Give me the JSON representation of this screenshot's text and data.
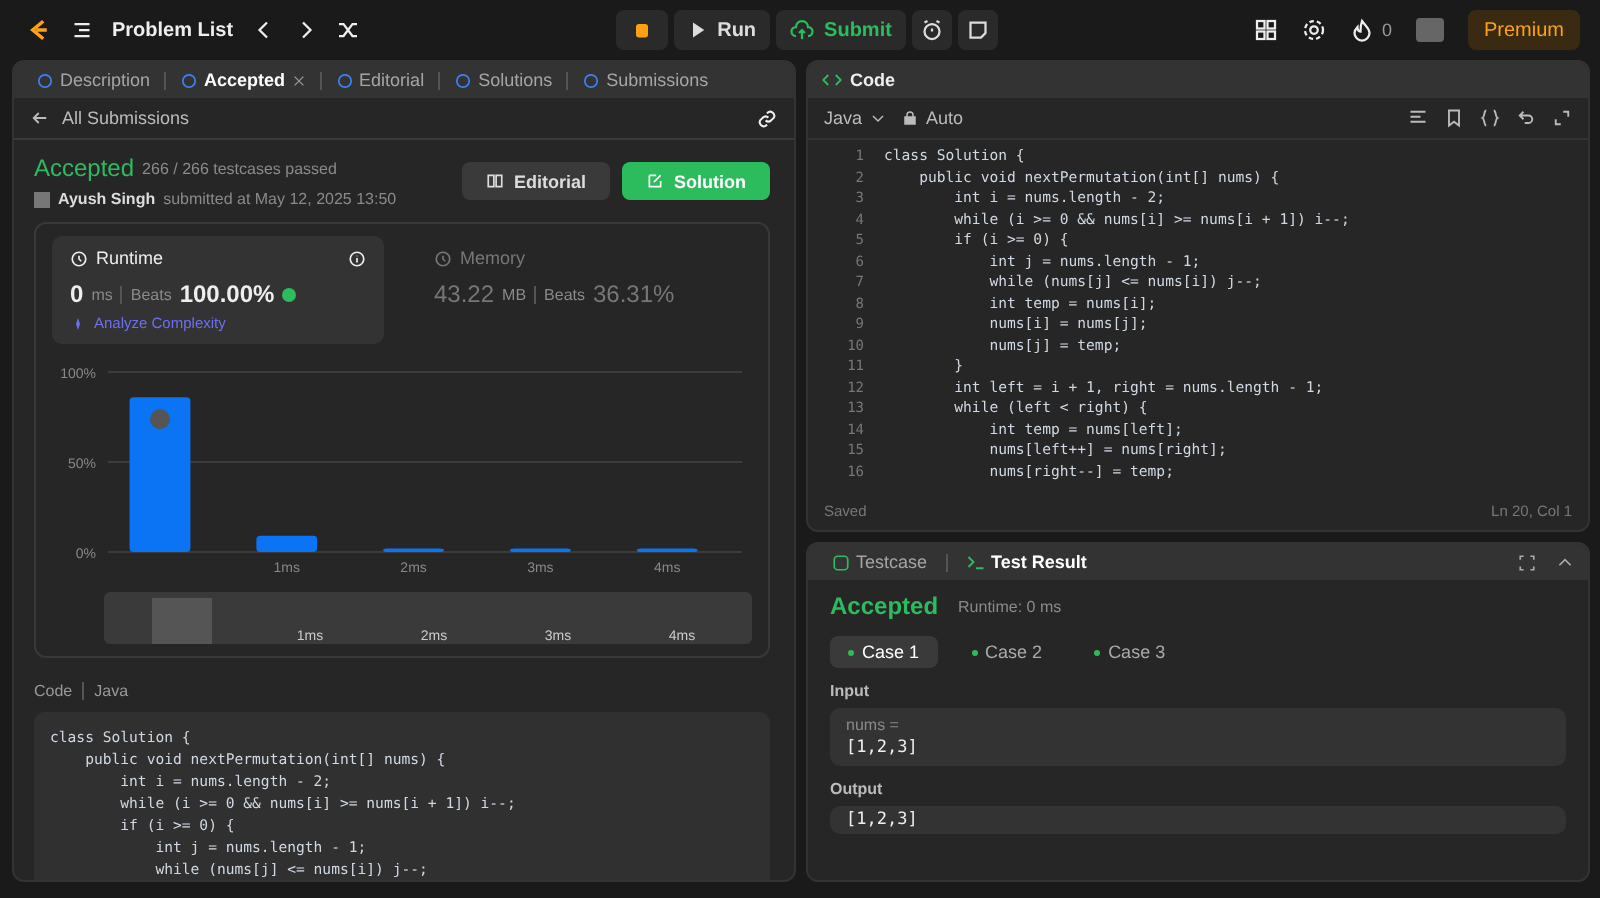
{
  "top_bar": {
    "title": "Problem List",
    "run": "Run",
    "submit": "Submit",
    "streak": "0",
    "premium": "Premium"
  },
  "left_tabs": [
    {
      "label": "Description",
      "selected": false,
      "closable": false
    },
    {
      "label": "Accepted",
      "selected": true,
      "closable": true
    },
    {
      "label": "Editorial",
      "selected": false,
      "closable": false
    },
    {
      "label": "Solutions",
      "selected": false,
      "closable": false
    },
    {
      "label": "Submissions",
      "selected": false,
      "closable": false
    }
  ],
  "back_link": "All Submissions",
  "submission": {
    "status": "Accepted",
    "testcases": "266 / 266 testcases passed",
    "author": "Ayush Singh",
    "submitted": "submitted at May 12, 2025 13:50",
    "buttons": [
      {
        "label": "Editorial",
        "kind": "secondary"
      },
      {
        "label": "Solution",
        "kind": "primary"
      }
    ]
  },
  "stats": [
    {
      "title": "Runtime",
      "value": "0",
      "unit": "ms",
      "beats_label": "Beats",
      "beats": "100.00%",
      "selected": true,
      "link": "Analyze Complexity"
    },
    {
      "title": "Memory",
      "value": "43.22",
      "unit": "MB",
      "beats_label": "Beats",
      "beats": "36.31%",
      "selected": false
    }
  ],
  "chart_data": {
    "type": "bar",
    "categories": [
      null,
      "1ms",
      "2ms",
      "3ms",
      "4ms"
    ],
    "values": [
      86,
      9,
      2,
      2,
      2
    ],
    "ylim": [
      0,
      100
    ],
    "yticks": [
      {
        "value": 0,
        "label": "0%"
      },
      {
        "value": 50,
        "label": "50%"
      },
      {
        "value": 100,
        "label": "100%"
      }
    ]
  },
  "brush_labels": [
    "1ms",
    "2ms",
    "3ms",
    "4ms"
  ],
  "code_section": {
    "label": "Code",
    "language": "Java",
    "lines": [
      "class Solution {",
      "    public void nextPermutation(int[] nums) {",
      "        int i = nums.length - 2;",
      "        while (i >= 0 && nums[i] >= nums[i + 1]) i--;",
      "        if (i >= 0) {",
      "            int j = nums.length - 1;",
      "            while (nums[j] <= nums[i]) j--;"
    ]
  },
  "editor": {
    "title": "Code",
    "language": "Java",
    "mode": "Auto",
    "line_numbers": [
      "1",
      "2",
      "3",
      "4",
      "5",
      "6",
      "7",
      "8",
      "9",
      "10",
      "11",
      "12",
      "13",
      "14",
      "15",
      "16"
    ],
    "lines": [
      "class Solution {",
      "    public void nextPermutation(int[] nums) {",
      "        int i = nums.length - 2;",
      "        while (i >= 0 && nums[i] >= nums[i + 1]) i--;",
      "        if (i >= 0) {",
      "            int j = nums.length - 1;",
      "            while (nums[j] <= nums[i]) j--;",
      "            int temp = nums[i];",
      "            nums[i] = nums[j];",
      "            nums[j] = temp;",
      "        }",
      "        int left = i + 1, right = nums.length - 1;",
      "        while (left < right) {",
      "            int temp = nums[left];",
      "            nums[left++] = nums[right];",
      "            nums[right--] = temp;"
    ],
    "status": "Saved",
    "cursor": "Ln 20, Col 1"
  },
  "result_tabs": [
    {
      "label": "Testcase",
      "selected": false
    },
    {
      "label": "Test Result",
      "selected": true
    }
  ],
  "result": {
    "status": "Accepted",
    "runtime": "Runtime: 0 ms",
    "cases": [
      {
        "label": "Case 1",
        "selected": true
      },
      {
        "label": "Case 2",
        "selected": false
      },
      {
        "label": "Case 3",
        "selected": false
      }
    ],
    "input_label": "Input",
    "input_name": "nums =",
    "input_value": "[1,2,3]",
    "output_label": "Output",
    "output_value": "[1,2,3]"
  }
}
